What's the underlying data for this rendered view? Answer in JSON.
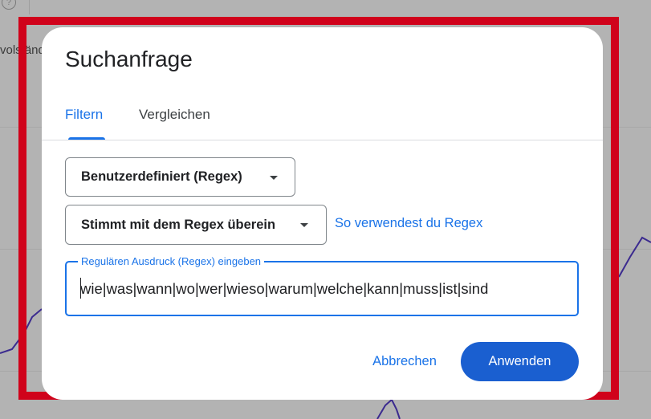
{
  "background": {
    "help_icon_glyph": "?",
    "truncated_text": "volständ"
  },
  "dialog": {
    "title": "Suchanfrage",
    "tabs": [
      {
        "label": "Filtern",
        "active": true
      },
      {
        "label": "Vergleichen",
        "active": false
      }
    ],
    "filter_type": {
      "selected": "Benutzerdefiniert (Regex)"
    },
    "match_type": {
      "selected": "Stimmt mit dem Regex überein"
    },
    "help_link": "So verwendest du Regex",
    "regex_input": {
      "label": "Regulären Ausdruck (Regex) eingeben",
      "value": "wie|was|wann|wo|wer|wieso|warum|welche|kann|muss|ist|sind"
    },
    "buttons": {
      "cancel": "Abbrechen",
      "apply": "Anwenden"
    }
  },
  "colors": {
    "accent": "#1a73e8",
    "primary_button": "#1a5fd0",
    "highlight_frame": "#d0021b",
    "scrim": "#b3b3b3",
    "chart_line": "#3b2a8f"
  }
}
